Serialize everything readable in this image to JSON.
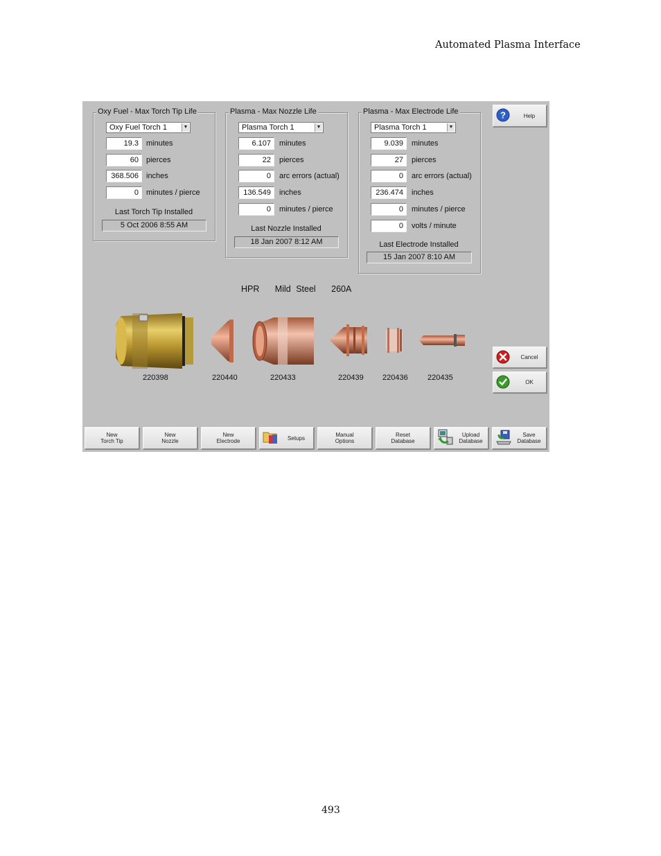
{
  "page": {
    "header": "Automated Plasma Interface",
    "page_number": "493"
  },
  "oxy_fuel": {
    "title": "Oxy Fuel - Max Torch Tip Life",
    "torch": "Oxy Fuel Torch 1",
    "rows": [
      {
        "value": "19.3",
        "unit": "minutes"
      },
      {
        "value": "60",
        "unit": "pierces"
      },
      {
        "value": "368.506",
        "unit": "inches"
      },
      {
        "value": "0",
        "unit": "minutes / pierce"
      }
    ],
    "last_label": "Last Torch Tip Installed",
    "last_date": "5 Oct 2006  8:55 AM"
  },
  "nozzle": {
    "title": "Plasma - Max Nozzle Life",
    "torch": "Plasma Torch 1",
    "rows": [
      {
        "value": "6.107",
        "unit": "minutes"
      },
      {
        "value": "22",
        "unit": "pierces"
      },
      {
        "value": "0",
        "unit": "arc errors (actual)"
      },
      {
        "value": "136.549",
        "unit": "inches"
      },
      {
        "value": "0",
        "unit": "minutes / pierce"
      }
    ],
    "last_label": "Last Nozzle Installed",
    "last_date": "18 Jan 2007  8:12 AM"
  },
  "electrode": {
    "title": "Plasma - Max Electrode Life",
    "torch": "Plasma Torch 1",
    "rows": [
      {
        "value": "9.039",
        "unit": "minutes"
      },
      {
        "value": "27",
        "unit": "pierces"
      },
      {
        "value": "0",
        "unit": "arc errors (actual)"
      },
      {
        "value": "236.474",
        "unit": "inches"
      },
      {
        "value": "0",
        "unit": "minutes / pierce"
      },
      {
        "value": "0",
        "unit": "volts / minute"
      }
    ],
    "last_label": "Last Electrode Installed",
    "last_date": "15 Jan 2007  8:10 AM"
  },
  "process_title": "HPR   Mild Steel   260A",
  "parts": [
    "220398",
    "220440",
    "220433",
    "220439",
    "220436",
    "220435"
  ],
  "side_buttons": {
    "help": "Help",
    "cancel": "Cancel",
    "ok": "OK"
  },
  "bottom_buttons": [
    {
      "label": "New\nTorch Tip",
      "icon": null
    },
    {
      "label": "New\nNozzle",
      "icon": null
    },
    {
      "label": "New\nElectrode",
      "icon": null
    },
    {
      "label": "Setups",
      "icon": "setups-icon"
    },
    {
      "label": "Manual\nOptions",
      "icon": null
    },
    {
      "label": "Reset\nDatabase",
      "icon": null
    },
    {
      "label": "Upload\nDatabase",
      "icon": "upload-icon"
    },
    {
      "label": "Save\nDatabase",
      "icon": "save-icon"
    }
  ],
  "colors": {
    "panel_bg": "#c0c0c0",
    "brass": "#b8952e",
    "copper": "#d9876a",
    "help_blue": "#2f5fc4",
    "cancel_red": "#cc1f1f",
    "ok_green": "#3a9a2a"
  }
}
